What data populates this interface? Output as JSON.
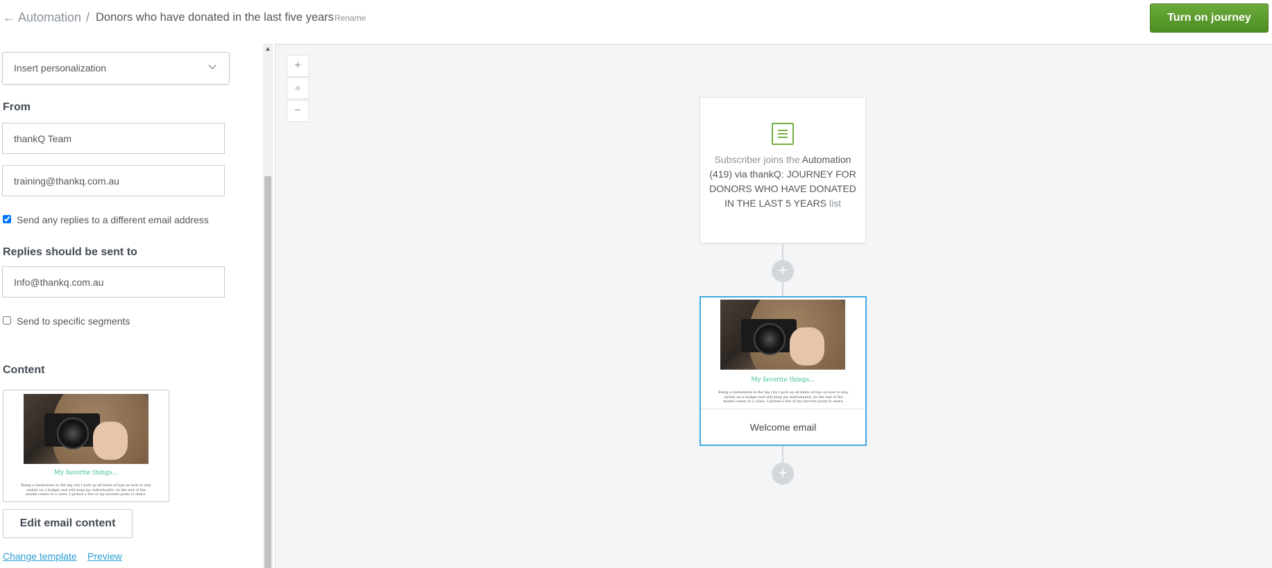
{
  "header": {
    "back_glyph": "←",
    "breadcrumb_link": "Automation",
    "separator": "/",
    "title": "Donors who have donated in the last five years",
    "rename_label": "Rename",
    "turn_on_label": "Turn on journey",
    "turn_on_color": "#5a9a2e"
  },
  "sidebar": {
    "personalization_label": "Insert personalization",
    "from_label": "From",
    "from_name": "thankQ Team",
    "from_email": "training@thankq.com.au",
    "reply_checkbox_label": "Send any replies to a different email address",
    "reply_checkbox_checked": true,
    "replies_label": "Replies should be sent to",
    "reply_email": "Info@thankq.com.au",
    "segments_checkbox_label": "Send to specific segments",
    "segments_checkbox_checked": false,
    "content_label": "Content",
    "thumb_heading": "My favorite things...",
    "thumb_body_1": "Being a fashionista in the big city I pick up all kinds of tips on how to stay",
    "thumb_body_2": "stylish on a budget and still keep my individuality. As the end of the",
    "thumb_body_3": "month comes to a close, I picked a few of my favorite posts to share.",
    "edit_button_label": "Edit email content",
    "change_template_label": "Change template",
    "preview_label": "Preview"
  },
  "canvas": {
    "zoom_in": "+",
    "zoom_fit": "⟡",
    "zoom_out": "−",
    "trigger_muted_1": "Subscriber joins the",
    "trigger_main": "Automation (419) via thankQ: JOURNEY FOR DONORS WHO HAVE DONATED IN THE LAST 5 YEARS",
    "trigger_muted_2": "list",
    "email_heading": "My favorite things...",
    "email_name": "Welcome email",
    "add_glyph": "+",
    "icon_color": "#73ad3f",
    "selected_border_color": "#41a8e0"
  }
}
